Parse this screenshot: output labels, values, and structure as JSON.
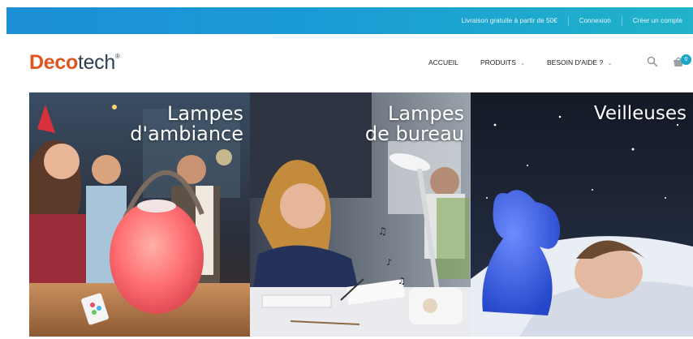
{
  "topbar": {
    "promo": "Livraison gratuite à partir de 50€",
    "login": "Connexion",
    "register": "Créer un compte"
  },
  "logo": {
    "part1": "Deco",
    "part2": "tech",
    "mark": "®"
  },
  "nav": {
    "home": "ACCUEIL",
    "products": "PRODUITS",
    "help": "BESOIN D'AIDE ?"
  },
  "cart": {
    "count": "0"
  },
  "icons": {
    "search": "search-icon",
    "cart": "cart-icon",
    "chevron": "chevron-down-icon"
  },
  "colors": {
    "brand_orange": "#e2541e",
    "brand_dark": "#2c3e50",
    "accent": "#1a9bd5"
  },
  "banners": [
    {
      "line1": "Lampes",
      "line2": "d'ambiance"
    },
    {
      "line1": "Lampes",
      "line2": "de bureau"
    },
    {
      "line1": "Veilleuses",
      "line2": ""
    }
  ]
}
